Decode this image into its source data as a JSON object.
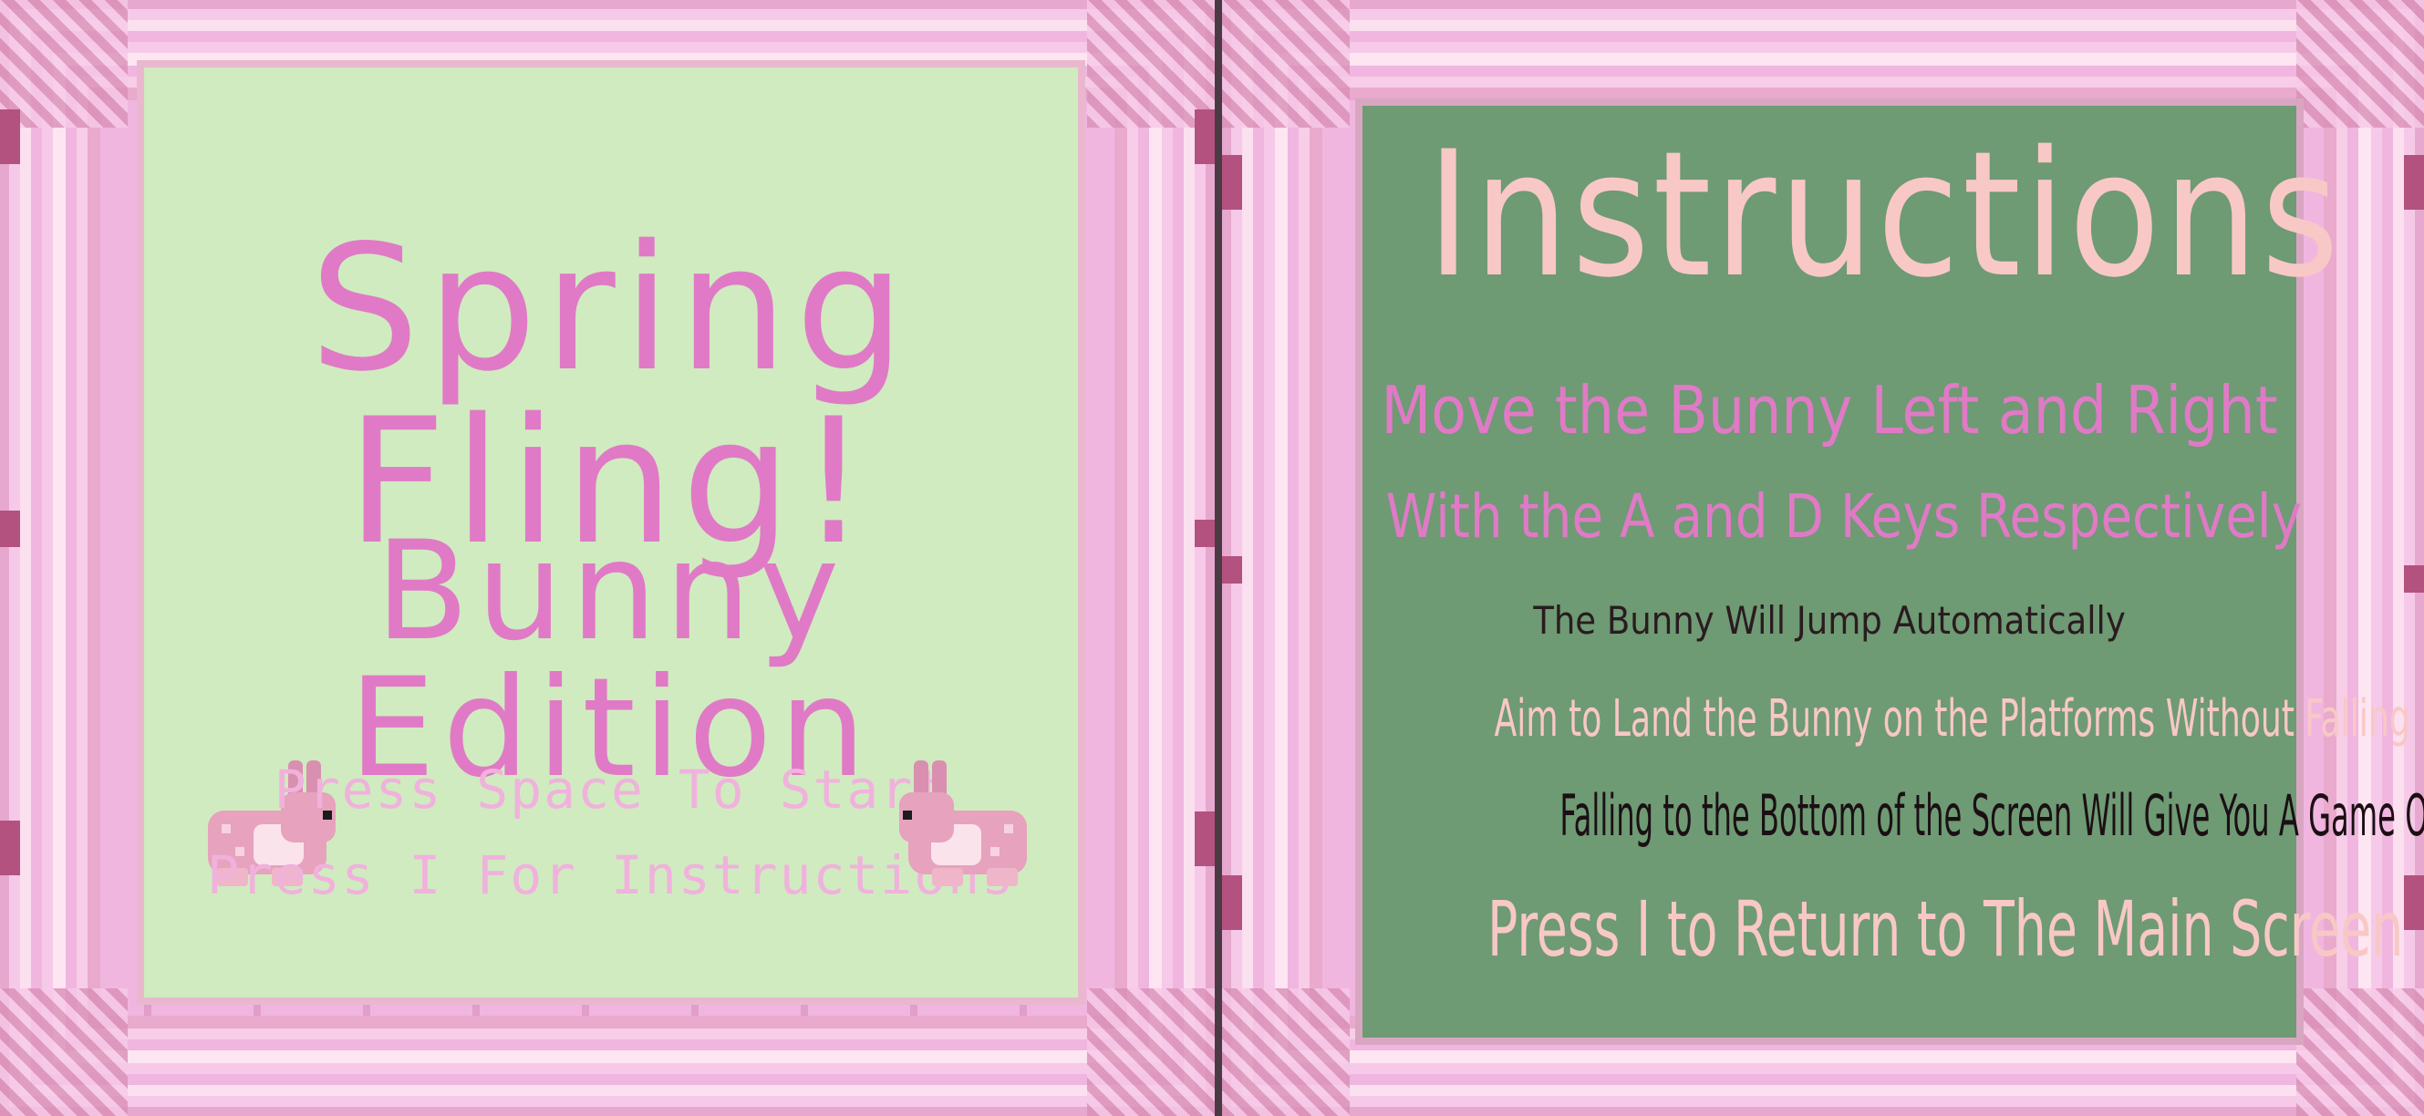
{
  "start_screen": {
    "title": "Spring Fling!",
    "subtitle": "Bunny Edition",
    "prompt_start": "Press Space To Start",
    "prompt_instructions": "Press I For Instructions"
  },
  "instructions_screen": {
    "title": "Instructions",
    "lines": [
      "Move the Bunny Left and Right",
      "With the A and D Keys Respectively",
      "The Bunny Will Jump Automatically",
      "Aim to Land the Bunny on the Platforms Without Falling",
      "Falling to the Bottom of the Screen Will Give You A Game Over",
      "Press I to Return to The Main Screen"
    ]
  },
  "colors": {
    "frame_pink": "#f0b6e0",
    "start_bg": "#d0ebc0",
    "instructions_bg": "#6e9a74",
    "title_pink": "#e07ac6",
    "light_pink": "#f8c8c6",
    "dark_text": "#1b0f14"
  },
  "icons": [
    "bunny-sprite-icon",
    "bunny-sprite-icon"
  ]
}
